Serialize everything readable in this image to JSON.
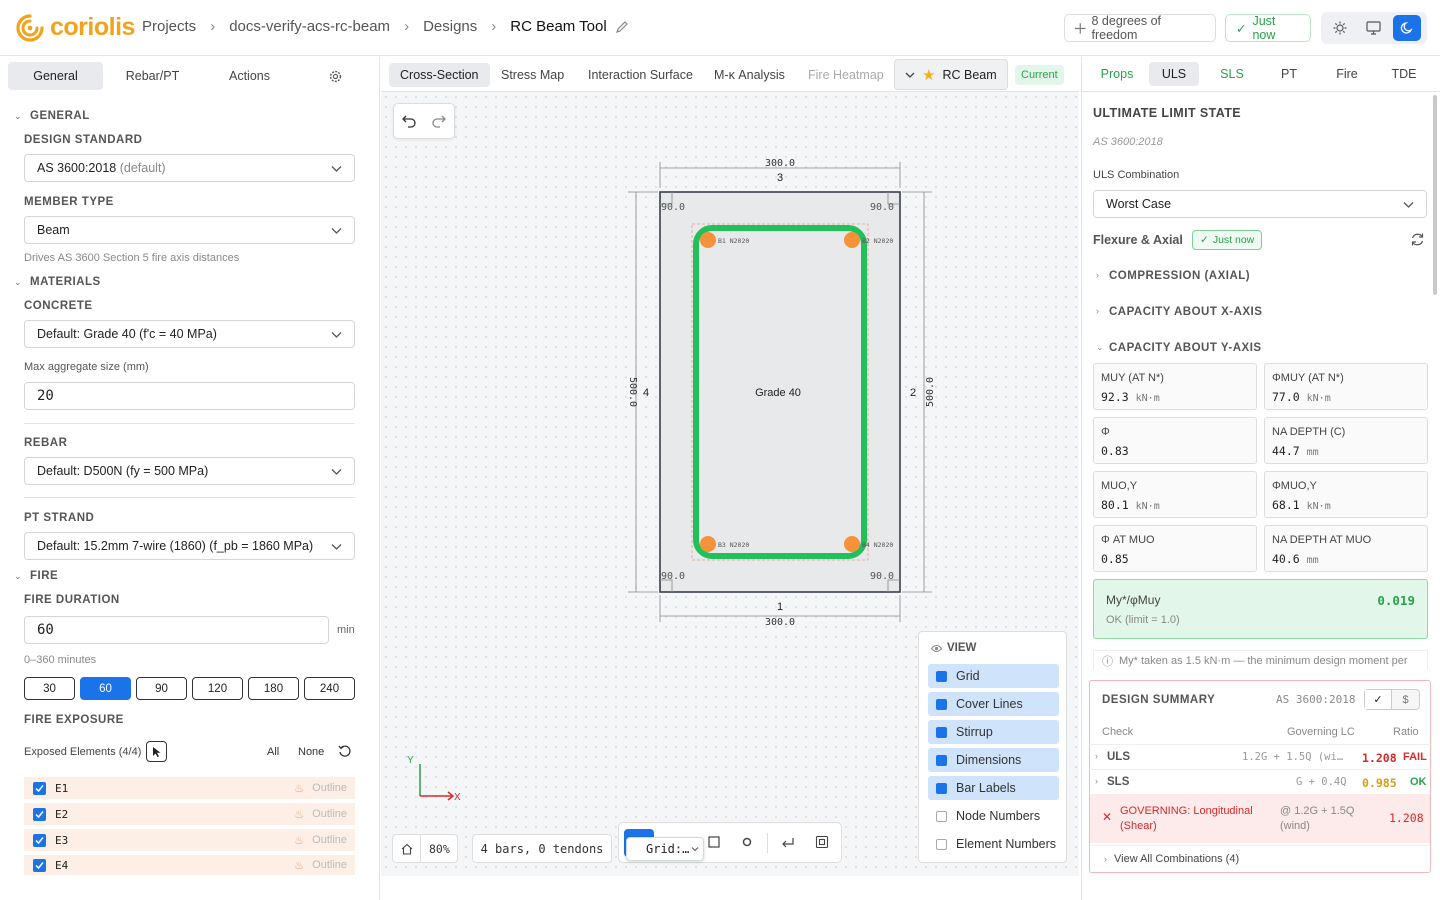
{
  "app": {
    "name": "coriolis",
    "brand_color": "#f2a31b"
  },
  "breadcrumb": [
    "Projects",
    "docs-verify-acs-rc-beam",
    "Designs",
    "RC Beam Tool"
  ],
  "header": {
    "dof": "8 degrees of freedom",
    "saved": "Just now"
  },
  "left": {
    "tabs": [
      "General",
      "Rebar/PT",
      "Actions"
    ],
    "general_title": "GENERAL",
    "design_standard_label": "DESIGN STANDARD",
    "design_standard_value": "AS 3600:2018",
    "design_standard_suffix": "(default)",
    "member_type_label": "MEMBER TYPE",
    "member_type_value": "Beam",
    "member_type_hint": "Drives AS 3600 Section 5 fire axis distances",
    "materials_title": "MATERIALS",
    "concrete_label": "CONCRETE",
    "concrete_value": "Default: Grade 40 (f'c = 40 MPa)",
    "agg_label": "Max aggregate size (mm)",
    "agg_value": "20",
    "rebar_label": "REBAR",
    "rebar_value": "Default: D500N (fy = 500 MPa)",
    "pt_label": "PT STRAND",
    "pt_value": "Default: 15.2mm 7-wire (1860) (f_pb = 1860 MPa)",
    "fire_title": "FIRE",
    "fire_duration_label": "FIRE DURATION",
    "fire_duration_value": "60",
    "fire_duration_unit": "min",
    "fire_duration_hint": "0–360 minutes",
    "fire_options": [
      "30",
      "60",
      "90",
      "120",
      "180",
      "240"
    ],
    "fire_selected": "60",
    "fire_exposure_label": "FIRE EXPOSURE",
    "exposed_label": "Exposed Elements (4/4)",
    "all_label": "All",
    "none_label": "None",
    "elements": [
      {
        "id": "E1",
        "mode": "Outline"
      },
      {
        "id": "E2",
        "mode": "Outline"
      },
      {
        "id": "E3",
        "mode": "Outline"
      },
      {
        "id": "E4",
        "mode": "Outline"
      }
    ]
  },
  "canvas": {
    "tabs": [
      "Cross-Section",
      "Stress Map",
      "Interaction Surface",
      "M-κ Analysis",
      "Fire Heatmap"
    ],
    "design_name": "RC Beam",
    "design_status": "Current",
    "section": {
      "width_top": "300.0",
      "width_bottom": "300.0",
      "height_left": "500.0",
      "height_right": "500.0",
      "edge_top": "3",
      "edge_right": "2",
      "edge_bottom": "1",
      "edge_left": "4",
      "cover_tl": "90.0",
      "cover_tr": "90.0",
      "cover_bl": "90.0",
      "cover_br": "90.0",
      "material_label": "Grade 40",
      "bars": [
        {
          "label": "B1 N2020"
        },
        {
          "label": "B2 N2020"
        },
        {
          "label": "B3 N2020"
        },
        {
          "label": "B4 N2020"
        }
      ]
    },
    "axis_x": "X",
    "axis_y": "Y",
    "zoom": "80%",
    "count_label": "4 bars, 0 tendons",
    "grid_select": "Grid:…",
    "view": {
      "title": "VIEW",
      "items": [
        {
          "label": "Grid",
          "checked": true
        },
        {
          "label": "Cover Lines",
          "checked": true
        },
        {
          "label": "Stirrup",
          "checked": true
        },
        {
          "label": "Dimensions",
          "checked": true
        },
        {
          "label": "Bar Labels",
          "checked": true
        },
        {
          "label": "Node Numbers",
          "checked": false
        },
        {
          "label": "Element Numbers",
          "checked": false
        }
      ]
    }
  },
  "right": {
    "tabs": [
      "Props",
      "ULS",
      "SLS",
      "PT",
      "Fire",
      "TDE"
    ],
    "active_tab": "ULS",
    "title": "ULTIMATE LIMIT STATE",
    "standard": "AS 3600:2018",
    "combo_label": "ULS Combination",
    "combo_value": "Worst Case",
    "flex_title": "Flexure & Axial",
    "flex_badge": "Just now",
    "acc_compression": "COMPRESSION (AXIAL)",
    "acc_x": "CAPACITY ABOUT X-AXIS",
    "acc_y": "CAPACITY ABOUT Y-AXIS",
    "cards": [
      {
        "title": "MUY (AT N*)",
        "value": "92.3",
        "unit": "kN·m"
      },
      {
        "title": "ΦMUY (AT N*)",
        "value": "77.0",
        "unit": "kN·m"
      },
      {
        "title": "Φ",
        "value": "0.83",
        "unit": ""
      },
      {
        "title": "NA DEPTH (C)",
        "value": "44.7",
        "unit": "mm"
      },
      {
        "title": "MUO,Y",
        "value": "80.1",
        "unit": "kN·m"
      },
      {
        "title": "ΦMUO,Y",
        "value": "68.1",
        "unit": "kN·m"
      },
      {
        "title": "Φ AT MUO",
        "value": "0.85",
        "unit": ""
      },
      {
        "title": "NA DEPTH AT MUO",
        "value": "40.6",
        "unit": "mm"
      }
    ],
    "ratio_label": "My*/φMuy",
    "ratio_value": "0.019",
    "ratio_status": "OK (limit = 1.0)",
    "note": "My* taken as 1.5 kN·m — the minimum design moment per",
    "summary": {
      "title": "DESIGN SUMMARY",
      "standard": "AS 3600:2018",
      "col_check": "Check",
      "col_lc": "Governing LC",
      "col_ratio": "Ratio",
      "rows": [
        {
          "check": "ULS",
          "lc": "1.2G + 1.5Q (wi…",
          "ratio": "1.208",
          "status": "FAIL"
        },
        {
          "check": "SLS",
          "lc": "G + 0.4Q",
          "ratio": "0.985",
          "status": "OK"
        }
      ],
      "governing_text": "GOVERNING: Longitudinal (Shear)",
      "governing_lc": "@ 1.2G + 1.5Q (wind)",
      "governing_ratio": "1.208",
      "view_all": "View All Combinations (4)"
    }
  },
  "colors": {
    "accent": "#1a73e8",
    "ok": "#27a34a",
    "fail": "#d62b2b",
    "stirrup": "#22c05a",
    "bar": "#f5923a"
  }
}
